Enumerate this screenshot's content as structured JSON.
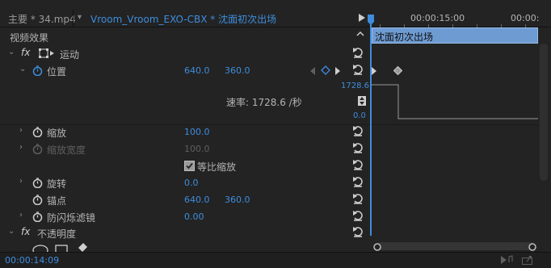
{
  "header": {
    "sequence_tab": "主要 * 34.mp4",
    "clip_tab": "Vroom_Vroom_EXO-CBX * 沈面初次出场",
    "timecode_ruler": "00:00:15:00",
    "timecode_ruler_cut": "00:00:"
  },
  "panel": {
    "title": "视频效果"
  },
  "timeline": {
    "clip_name": "沈面初次出场"
  },
  "effects": {
    "motion": {
      "label": "运动",
      "fx": "fx",
      "position": {
        "label": "位置",
        "x": "640.0",
        "y": "360.0"
      },
      "speed_label": "速率: 1728.6 /秒",
      "graph_max": "1728.6",
      "graph_min": "0.0",
      "scale": {
        "label": "缩放",
        "value": "100.0"
      },
      "scale_width": {
        "label": "缩放宽度",
        "value": "100.0"
      },
      "uniform": {
        "label": "等比缩放"
      },
      "rotation": {
        "label": "旋转",
        "value": "0.0"
      },
      "anchor": {
        "label": "锚点",
        "x": "640.0",
        "y": "360.0"
      },
      "flicker": {
        "label": "防闪烁滤镜",
        "value": "0.00"
      }
    },
    "opacity": {
      "label": "不透明度",
      "fx": "fx"
    }
  },
  "footer": {
    "timecode": "00:00:14:09"
  },
  "colors": {
    "accent": "#3e8ddd",
    "clip": "#6e9bd2",
    "bg": "#232323"
  }
}
